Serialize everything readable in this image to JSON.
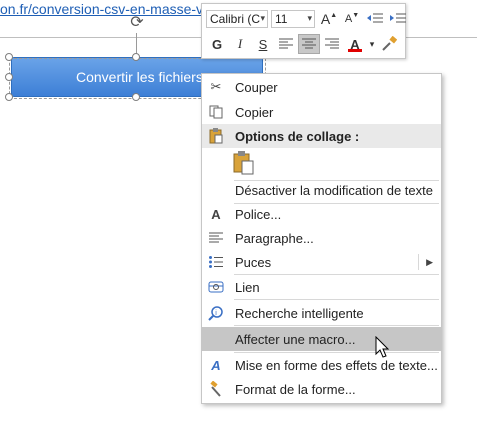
{
  "sheet": {
    "link_text": "on.fr/conversion-csv-en-masse-v"
  },
  "shape": {
    "label": "Convertir les fichiers"
  },
  "mini_toolbar": {
    "font_name": "Calibri (C",
    "font_size": "11",
    "bold": "G",
    "italic": "I",
    "underline": "S",
    "font_color_glyph": "A",
    "grow_glyph": "A",
    "shrink_glyph": "A"
  },
  "context_menu": {
    "items": [
      {
        "label": "Couper",
        "icon": "scissors-icon"
      },
      {
        "label": "Copier",
        "icon": "copy-icon"
      },
      {
        "label": "Options de collage :",
        "icon": "paste-icon",
        "header": true
      },
      {
        "label": "",
        "icon": "paste-option-icon"
      },
      {
        "label": "Désactiver la modification de texte",
        "icon": ""
      },
      {
        "label": "Police...",
        "icon": "font-icon"
      },
      {
        "label": "Paragraphe...",
        "icon": "paragraph-icon"
      },
      {
        "label": "Puces",
        "icon": "bullets-icon"
      },
      {
        "label": "Lien",
        "icon": "link-icon"
      },
      {
        "label": "Recherche intelligente",
        "icon": "smart-lookup-icon"
      },
      {
        "label": "Affecter une macro...",
        "icon": "",
        "highlighted": true
      },
      {
        "label": "Mise en forme des effets de texte...",
        "icon": "text-effects-icon"
      },
      {
        "label": "Format de la forme...",
        "icon": "format-shape-icon"
      }
    ]
  },
  "colors": {
    "shape_fill": "#4a8ce0",
    "highlight": "#c6c6c6",
    "header_bg": "#e9e9e9",
    "font_color_bar": "#e00000",
    "link": "#1f5fb5"
  }
}
